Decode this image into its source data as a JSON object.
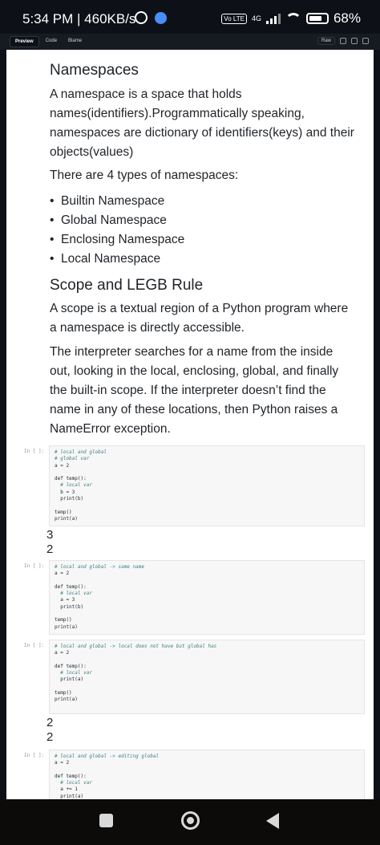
{
  "status_bar": {
    "time": "5:34 PM | 460KB/s",
    "volte": "Vo LTE",
    "network": "4G",
    "battery": "68%"
  },
  "tabbar": {
    "tabs": [
      "Preview",
      "Code",
      "Blame"
    ],
    "active_tab": "Preview",
    "raw_label": "Raw"
  },
  "doc": {
    "heading1": "Namespaces",
    "para1": "A namespace is a space that holds names(identifiers).Programmatically speaking, namespaces are dictionary of identifiers(keys) and their objects(values)",
    "para2": "There are 4 types of namespaces:",
    "namespace_types": [
      "Builtin Namespace",
      "Global Namespace",
      "Enclosing Namespace",
      "Local Namespace"
    ],
    "heading2": "Scope and LEGB Rule",
    "para3": "A scope is a textual region of a Python program where a namespace is directly accessible.",
    "para4": "The interpreter searches for a name from the inside out, looking in the local, enclosing, global, and finally the built-in scope. If the interpreter doesn’t find the name in any of these locations, then Python raises a NameError exception."
  },
  "cells": [
    {
      "prompt": "In [ ]:",
      "code": [
        "# local and global",
        "# global var",
        "a = 2",
        "",
        "def temp():",
        "  # local var",
        "  b = 3",
        "  print(b)",
        "",
        "temp()",
        "print(a)"
      ],
      "output": [
        "3",
        "2"
      ]
    },
    {
      "prompt": "In [ ]:",
      "code": [
        "# local and global -> same name",
        "a = 2",
        "",
        "def temp():",
        "  # local var",
        "  a = 3",
        "  print(b)",
        "",
        "temp()",
        "print(a)"
      ],
      "output": []
    },
    {
      "prompt": "In [ ]:",
      "code": [
        "# local and global -> local does not have but global has",
        "a = 2",
        "",
        "def temp():",
        "  # local var",
        "  print(a)",
        "",
        "temp()",
        "print(a)"
      ],
      "output": [
        "2",
        "2"
      ]
    },
    {
      "prompt": "In [ ]:",
      "code": [
        "# local and global -> editing global",
        "a = 2",
        "",
        "def temp():",
        "  # local var",
        "  a += 1",
        "  print(a)"
      ],
      "output": []
    }
  ]
}
